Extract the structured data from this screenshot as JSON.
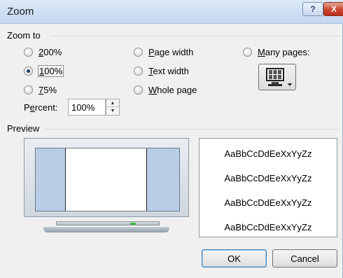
{
  "window": {
    "title": "Zoom",
    "help_label": "?",
    "close_label": "X"
  },
  "zoom_to": {
    "group_label": "Zoom to",
    "options": [
      {
        "key": "2",
        "rest": "00%",
        "checked": false
      },
      {
        "key": "1",
        "rest": "00%",
        "checked": true
      },
      {
        "key": "7",
        "rest": "5%",
        "checked": false
      },
      {
        "key": "P",
        "rest": "age width",
        "checked": false
      },
      {
        "key": "T",
        "rest": "ext width",
        "checked": false
      },
      {
        "key": "W",
        "rest": "hole page",
        "checked": false
      },
      {
        "key": "M",
        "rest": "any pages:",
        "checked": false
      }
    ],
    "percent_pre": "P",
    "percent_key": "e",
    "percent_post": "rcent:",
    "percent_value": "100%",
    "spin_up": "▲",
    "spin_down": "▼"
  },
  "preview": {
    "group_label": "Preview",
    "sample_text": "AaBbCcDdEeXxYyZz",
    "sample_lines": [
      "AaBbCcDdEeXxYyZz",
      "AaBbCcDdEeXxYyZz",
      "AaBbCcDdEeXxYyZz",
      "AaBbCcDdEeXxYyZz"
    ]
  },
  "buttons": {
    "ok": "OK",
    "cancel": "Cancel"
  },
  "icons": {
    "many_pages": "monitor-pages-icon"
  },
  "colors": {
    "titlebar": "#c4d7ef",
    "close": "#c8452c",
    "screen_blue": "#b9cde6"
  }
}
